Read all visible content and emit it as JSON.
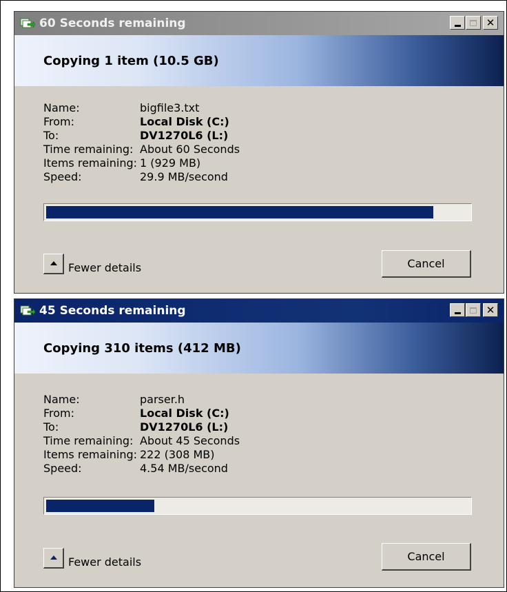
{
  "colors": {
    "titlebar_active": "#0a246a",
    "titlebar_inactive": "#808080",
    "progress_fill": "#0a246a",
    "dialog_face": "#d4d0c8"
  },
  "dialogs": [
    {
      "title": "60 Seconds remaining",
      "active": false,
      "icon": "file-copy-icon",
      "header": "Copying 1 item (10.5 GB)",
      "details": [
        {
          "label": "Name:",
          "value": "bigfile3.txt",
          "bold": false
        },
        {
          "label": "From:",
          "value": "Local Disk (C:)",
          "bold": true
        },
        {
          "label": "To:",
          "value": "DV1270L6 (L:)",
          "bold": true
        },
        {
          "label": "Time remaining:",
          "value": "About 60 Seconds",
          "bold": false
        },
        {
          "label": "Items remaining:",
          "value": "1 (929 MB)",
          "bold": false
        },
        {
          "label": "Speed:",
          "value": "29.9 MB/second",
          "bold": false
        }
      ],
      "progress_fraction": 0.915,
      "toggle_label": "Fewer details",
      "cancel_label": "Cancel"
    },
    {
      "title": "45 Seconds remaining",
      "active": true,
      "icon": "file-copy-icon",
      "header": "Copying 310 items (412 MB)",
      "details": [
        {
          "label": "Name:",
          "value": "parser.h",
          "bold": false
        },
        {
          "label": "From:",
          "value": "Local Disk (C:)",
          "bold": true
        },
        {
          "label": "To:",
          "value": "DV1270L6 (L:)",
          "bold": true
        },
        {
          "label": "Time remaining:",
          "value": "About 45 Seconds",
          "bold": false
        },
        {
          "label": "Items remaining:",
          "value": "222 (308 MB)",
          "bold": false
        },
        {
          "label": "Speed:",
          "value": "4.54 MB/second",
          "bold": false
        }
      ],
      "progress_fraction": 0.255,
      "toggle_label": "Fewer details",
      "cancel_label": "Cancel"
    }
  ]
}
